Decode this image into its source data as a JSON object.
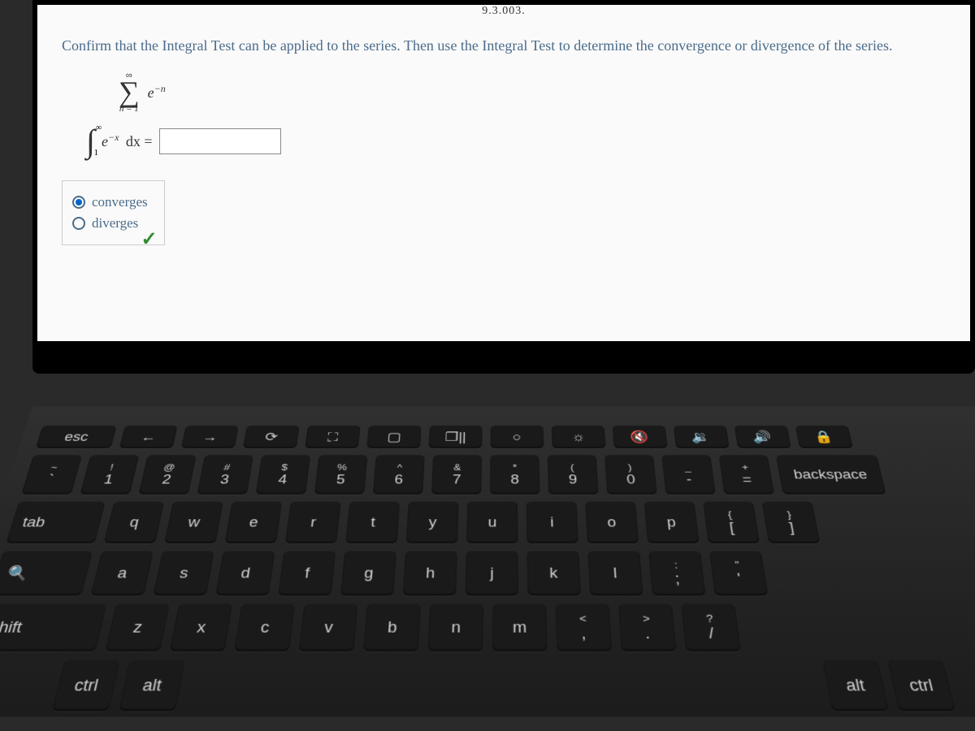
{
  "header_fragment": "9.3.003.",
  "question": "Confirm that the Integral Test can be applied to the series. Then use the Integral Test to determine the convergence or divergence of the series.",
  "series": {
    "sigma_upper": "∞",
    "sigma_lower": "n = 1",
    "expression_base": "e",
    "expression_exp": "−n"
  },
  "integral": {
    "upper": "∞",
    "lower": "1",
    "expression_base": "e",
    "expression_exp": "−x",
    "dx": "dx =",
    "input_value": ""
  },
  "choices": {
    "converges_label": "converges",
    "diverges_label": "diverges",
    "selected": "converges"
  },
  "keyboard": {
    "fn_row": [
      "esc",
      "←",
      "→",
      "⟳",
      "⛶",
      "▢",
      "❐||",
      "○",
      "☼",
      "🔇",
      "🔉",
      "🔊",
      "🔒"
    ],
    "num_row_upper": [
      "~",
      "!",
      "@",
      "#",
      "$",
      "%",
      "^",
      "&",
      "*",
      "(",
      ")",
      "_",
      "+",
      "backspace"
    ],
    "num_row_lower": [
      "`",
      "1",
      "2",
      "3",
      "4",
      "5",
      "6",
      "7",
      "8",
      "9",
      "0",
      "-",
      "="
    ],
    "qwerty_row": [
      "tab",
      "q",
      "w",
      "e",
      "r",
      "t",
      "y",
      "u",
      "i",
      "o",
      "p",
      "[",
      "]"
    ],
    "qwerty_row_upper": [
      "",
      "",
      "",
      "",
      "",
      "",
      "",
      "",
      "",
      "",
      "",
      "{",
      "}"
    ],
    "asdf_row": [
      "🔍",
      "a",
      "s",
      "d",
      "f",
      "g",
      "h",
      "j",
      "k",
      "l",
      ";",
      "'"
    ],
    "asdf_row_upper": [
      "",
      "",
      "",
      "",
      "",
      "",
      "",
      "",
      "",
      "",
      ":",
      "\""
    ],
    "zxcv_row": [
      "shift",
      "z",
      "x",
      "c",
      "v",
      "b",
      "n",
      "m",
      ",",
      ".",
      "/"
    ],
    "zxcv_row_upper": [
      "",
      "",
      "",
      "",
      "",
      "",
      "",
      "",
      "<",
      ">",
      "?"
    ],
    "bottom_row": [
      "ctrl",
      "alt"
    ],
    "bottom_right": [
      "alt",
      "ctrl"
    ]
  }
}
